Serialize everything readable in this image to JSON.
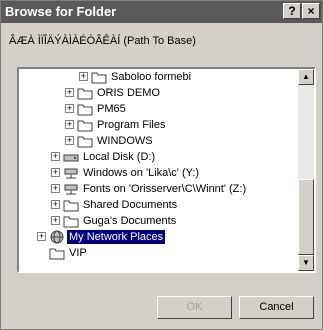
{
  "window": {
    "title": "Browse for Folder"
  },
  "titlebar": {
    "help_label": "?",
    "close_label": "×"
  },
  "prompt": {
    "text": "ÂÆÀ ÌÏÎÄÝÀÌÀÉÒÂÊÀÍ (Path To Base)"
  },
  "tree": {
    "items": [
      {
        "label": "Saboloo formebi",
        "expand": "+",
        "icon": "folder-icon"
      },
      {
        "label": "ORIS DEMO",
        "expand": "+",
        "icon": "folder-icon"
      },
      {
        "label": "PM65",
        "expand": "+",
        "icon": "folder-icon"
      },
      {
        "label": "Program Files",
        "expand": "+",
        "icon": "folder-icon"
      },
      {
        "label": "WINDOWS",
        "expand": "+",
        "icon": "folder-icon"
      },
      {
        "label": "Local Disk (D:)",
        "expand": "+",
        "icon": "drive-icon"
      },
      {
        "label": "Windows on 'Lika\\c' (Y:)",
        "expand": "+",
        "icon": "network-drive-icon"
      },
      {
        "label": "Fonts on 'Orisserver\\C\\Winnt' (Z:)",
        "expand": "+",
        "icon": "network-drive-icon"
      },
      {
        "label": "Shared Documents",
        "expand": "+",
        "icon": "folder-icon"
      },
      {
        "label": "Guga's Documents",
        "expand": "+",
        "icon": "folder-icon"
      },
      {
        "label": "My Network Places",
        "expand": "+",
        "icon": "network-places-icon",
        "selected": true
      },
      {
        "label": "VIP",
        "expand": "",
        "icon": "folder-icon"
      }
    ]
  },
  "scrollbar": {
    "up_label": "▲",
    "down_label": "▼"
  },
  "buttons": {
    "ok": "OK",
    "cancel": "Cancel"
  }
}
